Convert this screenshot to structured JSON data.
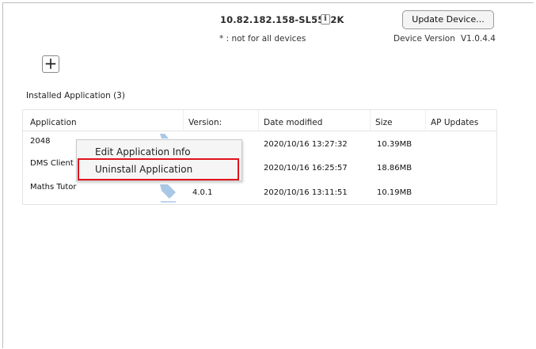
{
  "header": {
    "device_id": "10.82.182.158-SL5502K",
    "info_icon_text": "i",
    "note": "* : not for all devices",
    "update_button": "Update Device...",
    "device_version_label": "Device Version",
    "device_version_value": "V1.0.4.4"
  },
  "toolbar": {
    "add_label": "+"
  },
  "section": {
    "title": "Installed Application (3)"
  },
  "table": {
    "columns": [
      "Application",
      "Version:",
      "Date modified",
      "Size",
      "AP Updates"
    ],
    "rows": [
      {
        "name": "2048",
        "version": "",
        "date": "2020/10/16 13:27:32",
        "size": "10.39MB"
      },
      {
        "name": "DMS Client",
        "version": "",
        "date": "2020/10/16 16:25:57",
        "size": "18.86MB"
      },
      {
        "name": "Maths Tutor",
        "version": "4.0.1",
        "date": "2020/10/16 13:11:51",
        "size": "10.19MB"
      }
    ]
  },
  "context_menu": {
    "items": [
      "Edit Application Info",
      "Uninstall Application"
    ]
  },
  "colors": {
    "highlight": "#e0141b",
    "tag_icon": "#a9c8e6"
  }
}
